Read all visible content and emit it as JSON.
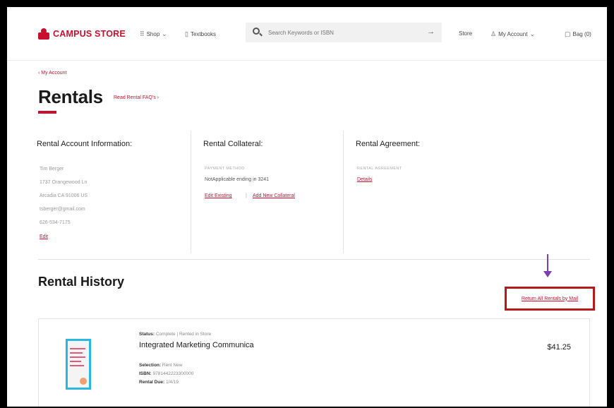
{
  "header": {
    "logo_text": "CAMPUS STORE",
    "nav": {
      "shop": "Shop",
      "textbooks": "Textbooks",
      "store": "Store",
      "my_account": "My Account",
      "bag": "Bag (0)"
    },
    "search": {
      "placeholder": "Search Keywords or ISBN"
    }
  },
  "page": {
    "back_link": "My Account",
    "title": "Rentals",
    "faq_link": "Read Rental FAQ's"
  },
  "account_info": {
    "heading": "Rental Account Information:",
    "lines": [
      "Tim Berger",
      "1737 Orangewood Ln",
      "Arcadia CA 91006 US",
      "tsberger@gmail.com",
      "626-534-7175"
    ],
    "edit_link": "Edit"
  },
  "collateral": {
    "heading": "Rental Collateral:",
    "label": "PAYMENT METHOD",
    "card_text": "NotApplicable ending in 3241",
    "edit_link": "Edit Existing",
    "separator": "|",
    "add_link": "Add New Collateral"
  },
  "agreement": {
    "heading": "Rental Agreement:",
    "label": "RENTAL AGREEMENT",
    "details_link": "Details"
  },
  "history": {
    "title": "Rental History",
    "return_all_link": "Return All Rentals by Mail"
  },
  "rental_item": {
    "status_label": "Status:",
    "status_value": "Complete | Rented in Store",
    "title": "Integrated Marketing Communica",
    "selection_label": "Selection:",
    "selection_value": "Rent New",
    "isbn_label": "ISBN:",
    "isbn_value": "9781442223300000",
    "due_label": "Rental Due:",
    "due_value": "1/4/19",
    "price": "$41.25"
  },
  "colors": {
    "brand_red": "#c8102e",
    "annotation_box": "#b31b1b",
    "annotation_arrow": "#7b3fb0"
  }
}
